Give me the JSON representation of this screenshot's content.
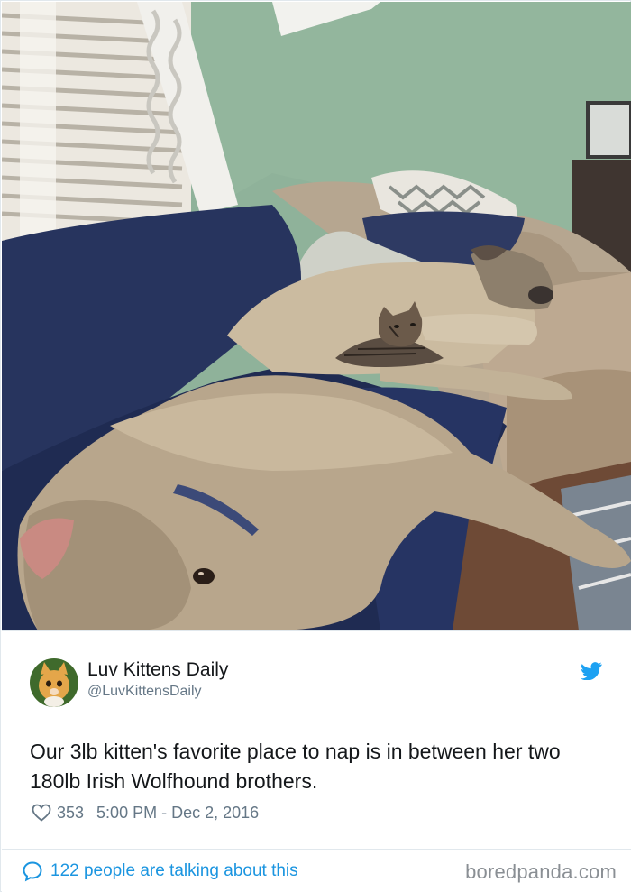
{
  "photo": {
    "icon": "dogs-and-kitten-photo"
  },
  "tweet": {
    "author_name": "Luv Kittens Daily",
    "author_handle": "@LuvKittensDaily",
    "text": "Our 3lb kitten's favorite place to nap is in between her two 180lb Irish Wolfhound brothers.",
    "likes": "353",
    "timestamp": "5:00 PM - Dec 2, 2016"
  },
  "footer": {
    "talking": "122 people are talking about this",
    "watermark": "boredpanda.com"
  },
  "colors": {
    "twitter_blue": "#1da1f2",
    "link_blue": "#1b95e0",
    "secondary_text": "#657786",
    "border": "#e1e8ed"
  }
}
